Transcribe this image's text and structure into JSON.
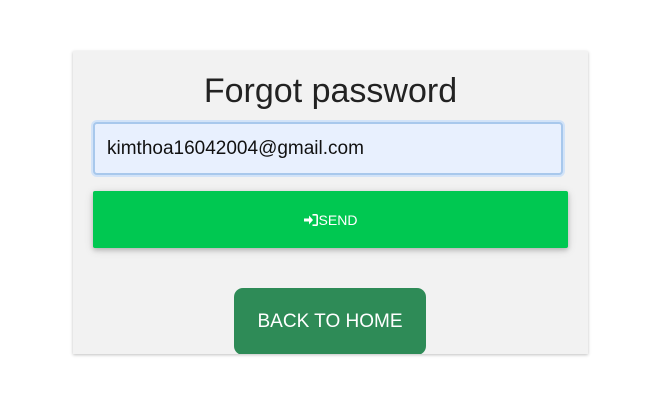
{
  "page": {
    "title": "Forgot password"
  },
  "form": {
    "email_value": "kimthoa16042004@gmail.com",
    "send_label": "SEND",
    "send_icon": "sign-in-icon"
  },
  "footer": {
    "back_home_label": "BACK TO HOME"
  },
  "colors": {
    "card_background": "#f2f2f2",
    "send_button": "#00c851",
    "home_button": "#2e8b57",
    "input_background": "#e8f0fe",
    "input_border": "#a8c8ec"
  }
}
